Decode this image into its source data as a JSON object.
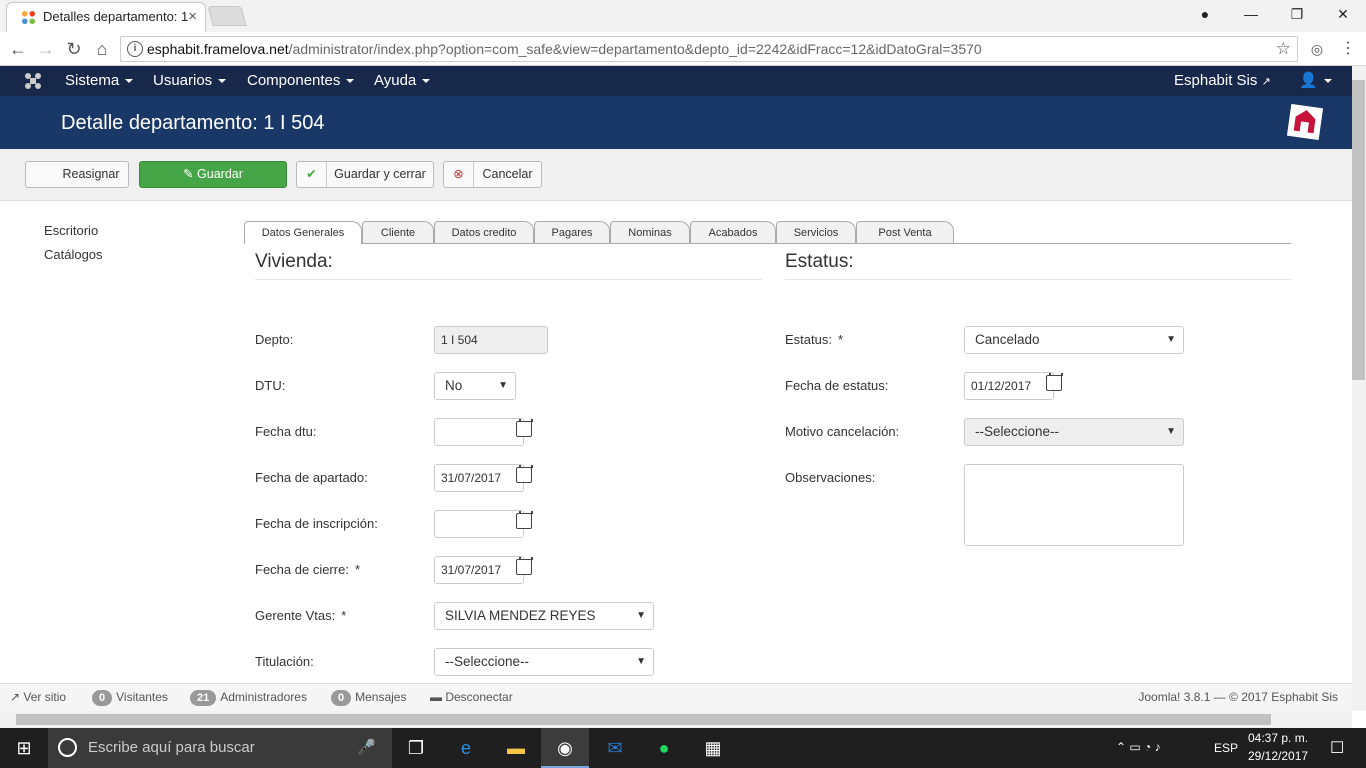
{
  "browser": {
    "tab_title": "Detalles departamento: 1",
    "url_host": "esphabit.framelova.net",
    "url_path": "/administrator/index.php?option=com_safe&view=departamento&depto_id=2242&idFracc=12&idDatoGral=3570"
  },
  "topnav": {
    "menus": [
      "Sistema",
      "Usuarios",
      "Componentes",
      "Ayuda"
    ],
    "site_link": "Esphabit Sis"
  },
  "header": {
    "title": "Detalle departamento: 1 I 504"
  },
  "toolbar": {
    "reasignar": "Reasignar",
    "guardar": "Guardar",
    "guardar_cerrar": "Guardar y cerrar",
    "cancelar": "Cancelar"
  },
  "sidebar": {
    "items": [
      "Escritorio",
      "Catálogos"
    ]
  },
  "tabs": [
    "Datos Generales",
    "Cliente",
    "Datos credito",
    "Pagares",
    "Nominas",
    "Acabados",
    "Servicios",
    "Post Venta"
  ],
  "vivienda": {
    "title": "Vivienda:",
    "depto_label": "Depto:",
    "depto_value": "1 I 504",
    "dtu_label": "DTU:",
    "dtu_value": "No",
    "fecha_dtu_label": "Fecha dtu:",
    "fecha_dtu_value": "",
    "fecha_apartado_label": "Fecha de apartado:",
    "fecha_apartado_value": "31/07/2017",
    "fecha_inscripcion_label": "Fecha de inscripción:",
    "fecha_inscripcion_value": "",
    "fecha_cierre_label": "Fecha de cierre:",
    "fecha_cierre_value": "31/07/2017",
    "gerente_label": "Gerente Vtas:",
    "gerente_value": "SILVIA MENDEZ REYES",
    "titulacion_label": "Titulación:",
    "titulacion_value": "--Seleccione--"
  },
  "estatus": {
    "title": "Estatus:",
    "estatus_label": "Estatus:",
    "estatus_value": "Cancelado",
    "fecha_label": "Fecha de estatus:",
    "fecha_value": "01/12/2017",
    "motivo_label": "Motivo cancelación:",
    "motivo_value": "--Seleccione--",
    "observaciones_label": "Observaciones:",
    "observaciones_value": ""
  },
  "statusbar": {
    "ver_sitio": "Ver sitio",
    "visitantes_count": "0",
    "visitantes": "Visitantes",
    "admins_count": "21",
    "admins": "Administradores",
    "mensajes_count": "0",
    "mensajes": "Mensajes",
    "desconectar": "Desconectar",
    "footer": "Joomla! 3.8.1  —  © 2017 Esphabit Sis"
  },
  "taskbar": {
    "search_placeholder": "Escribe aquí para buscar",
    "lang": "ESP",
    "time": "04:37 p. m.",
    "date": "29/12/2017"
  },
  "colors": {
    "topnav": "#17284a",
    "subheader": "#1a3867",
    "guardar": "#46a546"
  }
}
